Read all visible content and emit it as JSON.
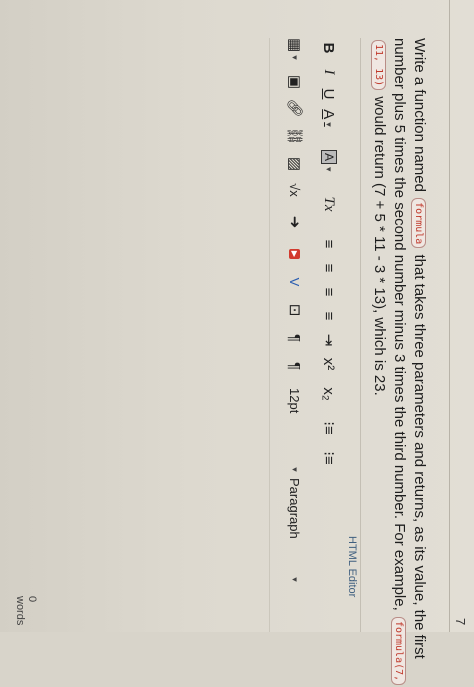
{
  "question": {
    "number": "7",
    "text_part1": "Write a function named",
    "code1": "formula",
    "text_part2": "that takes three parameters and returns, as its value, the first",
    "line2": "number plus 5 times the second number minus 3 times the third number. For example,",
    "code2": "formula(7,",
    "code3": "11, 13)",
    "line3": "would return (7 + 5 * 11 - 3 * 13), which is 23."
  },
  "editor": {
    "html_editor_label": "HTML Editor",
    "toolbar_row1": [
      {
        "name": "bold-button",
        "label": "B"
      },
      {
        "name": "italic-button",
        "label": "I"
      },
      {
        "name": "underline-button",
        "label": "U"
      },
      {
        "name": "text-color-button",
        "label": "A"
      },
      {
        "name": "background-color-button",
        "label": "A"
      },
      {
        "name": "clear-formatting-button",
        "label": "Tx"
      },
      {
        "name": "align-left-button",
        "label": "≡"
      },
      {
        "name": "align-center-button",
        "label": "≡"
      },
      {
        "name": "align-right-button",
        "label": "≡"
      },
      {
        "name": "justify-button",
        "label": "≡"
      },
      {
        "name": "superscript-button",
        "label": "x²"
      },
      {
        "name": "subscript-button",
        "label": "x₂"
      },
      {
        "name": "bullet-list-button",
        "label": "⁝≡"
      },
      {
        "name": "numbered-list-button",
        "label": "⁝≡"
      }
    ],
    "font_size": "12pt",
    "paragraph": "Paragraph",
    "math_label": "√x",
    "word_count": "0 words"
  }
}
